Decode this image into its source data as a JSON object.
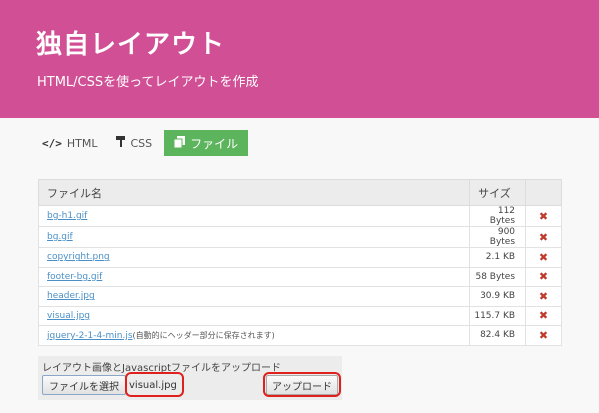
{
  "header": {
    "title": "独自レイアウト",
    "subtitle": "HTML/CSSを使ってレイアウトを作成",
    "background": "#d14f95"
  },
  "tabs": [
    {
      "label": "HTML",
      "icon": "code-icon",
      "active": false
    },
    {
      "label": "CSS",
      "icon": "paint-roller-icon",
      "active": false
    },
    {
      "label": "ファイル",
      "icon": "files-icon",
      "active": true
    }
  ],
  "table": {
    "headers": [
      "ファイル名",
      "サイズ",
      ""
    ],
    "rows": [
      {
        "name": "bg-h1.gif",
        "note": "",
        "size": "112 Bytes"
      },
      {
        "name": "bg.gif",
        "note": "",
        "size": "900 Bytes"
      },
      {
        "name": "copyright.png",
        "note": "",
        "size": "2.1 KB"
      },
      {
        "name": "footer-bg.gif",
        "note": "",
        "size": "58 Bytes"
      },
      {
        "name": "header.jpg",
        "note": "",
        "size": "30.9 KB"
      },
      {
        "name": "visual.jpg",
        "note": "",
        "size": "115.7 KB"
      },
      {
        "name": "jquery-2-1-4-min.js",
        "note": "(自動的にヘッダー部分に保存されます)",
        "size": "82.4 KB"
      }
    ],
    "delete_icon": "delete-x-icon"
  },
  "upload": {
    "label": "レイアウト画像とJavascriptファイルをアップロード",
    "choose_label": "ファイルを選択",
    "file_name": "visual.jpg",
    "submit_label": "アップロード"
  },
  "colors": {
    "accent": "#5cb45c",
    "link": "#4a90c8",
    "delete": "#c0392b",
    "highlight": "#e0201c"
  }
}
